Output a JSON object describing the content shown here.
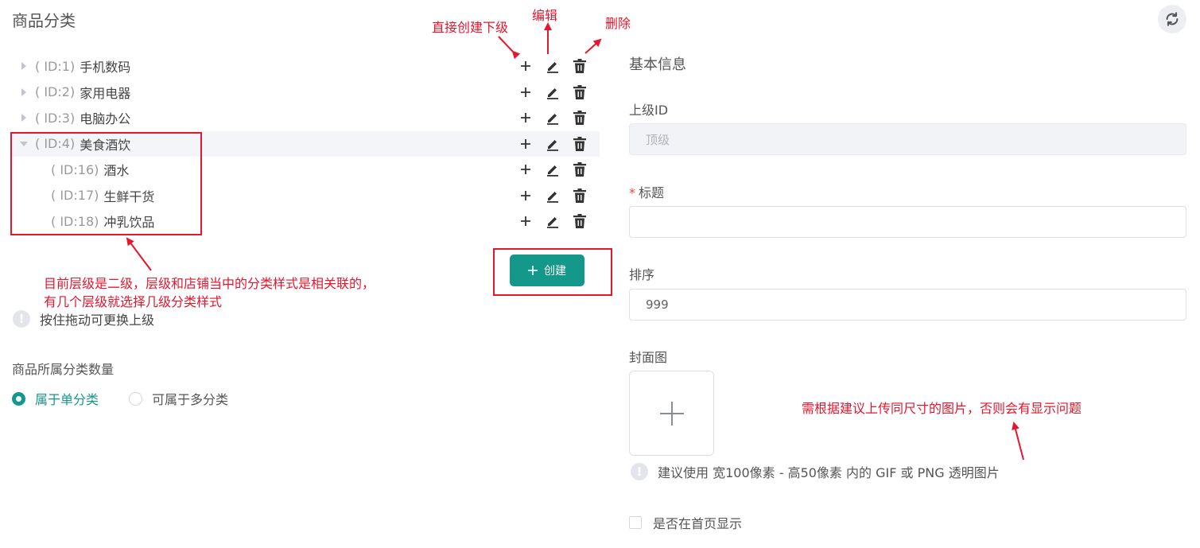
{
  "page": {
    "title": "商品分类"
  },
  "tree": {
    "rows": [
      {
        "id": "( ID:1)",
        "name": "手机数码",
        "expanded": false,
        "level": 1
      },
      {
        "id": "( ID:2)",
        "name": "家用电器",
        "expanded": false,
        "level": 1
      },
      {
        "id": "( ID:3)",
        "name": "电脑办公",
        "expanded": false,
        "level": 1
      },
      {
        "id": "( ID:4)",
        "name": "美食酒饮",
        "expanded": true,
        "level": 1
      },
      {
        "id": "( ID:16)",
        "name": "酒水",
        "level": 2
      },
      {
        "id": "( ID:17)",
        "name": "生鲜干货",
        "level": 2
      },
      {
        "id": "( ID:18)",
        "name": "冲乳饮品",
        "level": 2
      }
    ],
    "actions": [
      "add-icon",
      "edit-icon",
      "delete-icon"
    ]
  },
  "create_button": {
    "label": "创建",
    "color": "#13988a"
  },
  "drag_tip": "按住拖动可更换上级",
  "category_count": {
    "label": "商品所属分类数量",
    "options": [
      {
        "label": "属于单分类",
        "checked": true
      },
      {
        "label": "可属于多分类",
        "checked": false
      }
    ]
  },
  "form": {
    "heading": "基本信息",
    "parent": {
      "label": "上级ID",
      "value": "顶级",
      "disabled": true
    },
    "title": {
      "label": "标题",
      "required": "*",
      "value": ""
    },
    "sort": {
      "label": "排序",
      "value": "999"
    },
    "cover": {
      "label": "封面图",
      "tip": "建议使用 宽100像素 - 高50像素 内的 GIF 或 PNG 透明图片"
    },
    "show_home": {
      "label": "是否在首页显示",
      "checked": false
    }
  },
  "annotations": {
    "create_child": "直接创建下级",
    "edit": "编辑",
    "delete": "删除",
    "level_note_line1": "目前层级是二级，层级和店铺当中的分类样式是相关联的，",
    "level_note_line2": "有几个层级就选择几级分类样式",
    "image_note": "需根据建议上传同尺寸的图片，否则会有显示问题",
    "color": "#e3172d"
  }
}
